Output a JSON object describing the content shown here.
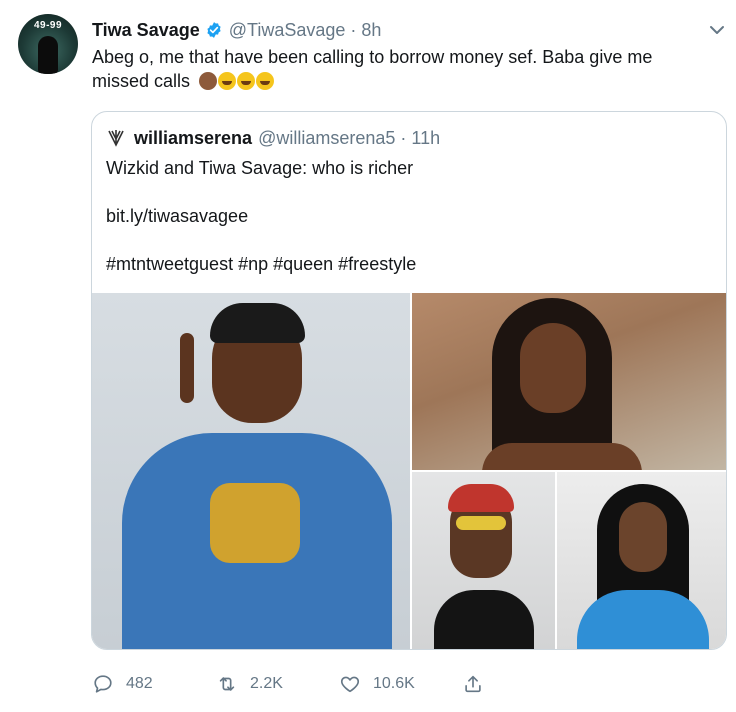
{
  "tweet": {
    "author_name": "Tiwa Savage",
    "handle": "@TiwaSavage",
    "separator": "·",
    "time": "8h",
    "avatar_text": "49-99",
    "text": "Abeg o, me that have been calling to borrow money sef. Baba give me missed calls",
    "emojis": [
      "see-no-evil-monkey-emoji",
      "rofl-emoji",
      "rofl-emoji",
      "rofl-emoji"
    ]
  },
  "quoted": {
    "author_name": "williamserena",
    "handle": "@williamserena5",
    "separator": "·",
    "time": "11h",
    "line1": "Wizkid and Tiwa Savage: who is richer",
    "line2": "bit.ly/tiwasavagee",
    "line3": "#mtntweetguest #np #queen #freestyle",
    "photos": [
      "photo-woman-pointing",
      "photo-woman-portrait",
      "photo-man-sunglasses",
      "photo-woman-blue-hoodie"
    ]
  },
  "actions": {
    "replies": "482",
    "retweets": "2.2K",
    "likes": "10.6K"
  },
  "colors": {
    "text": "#14171a",
    "secondary": "#657786",
    "verified": "#1da1f2",
    "border": "#ccd6dd"
  }
}
